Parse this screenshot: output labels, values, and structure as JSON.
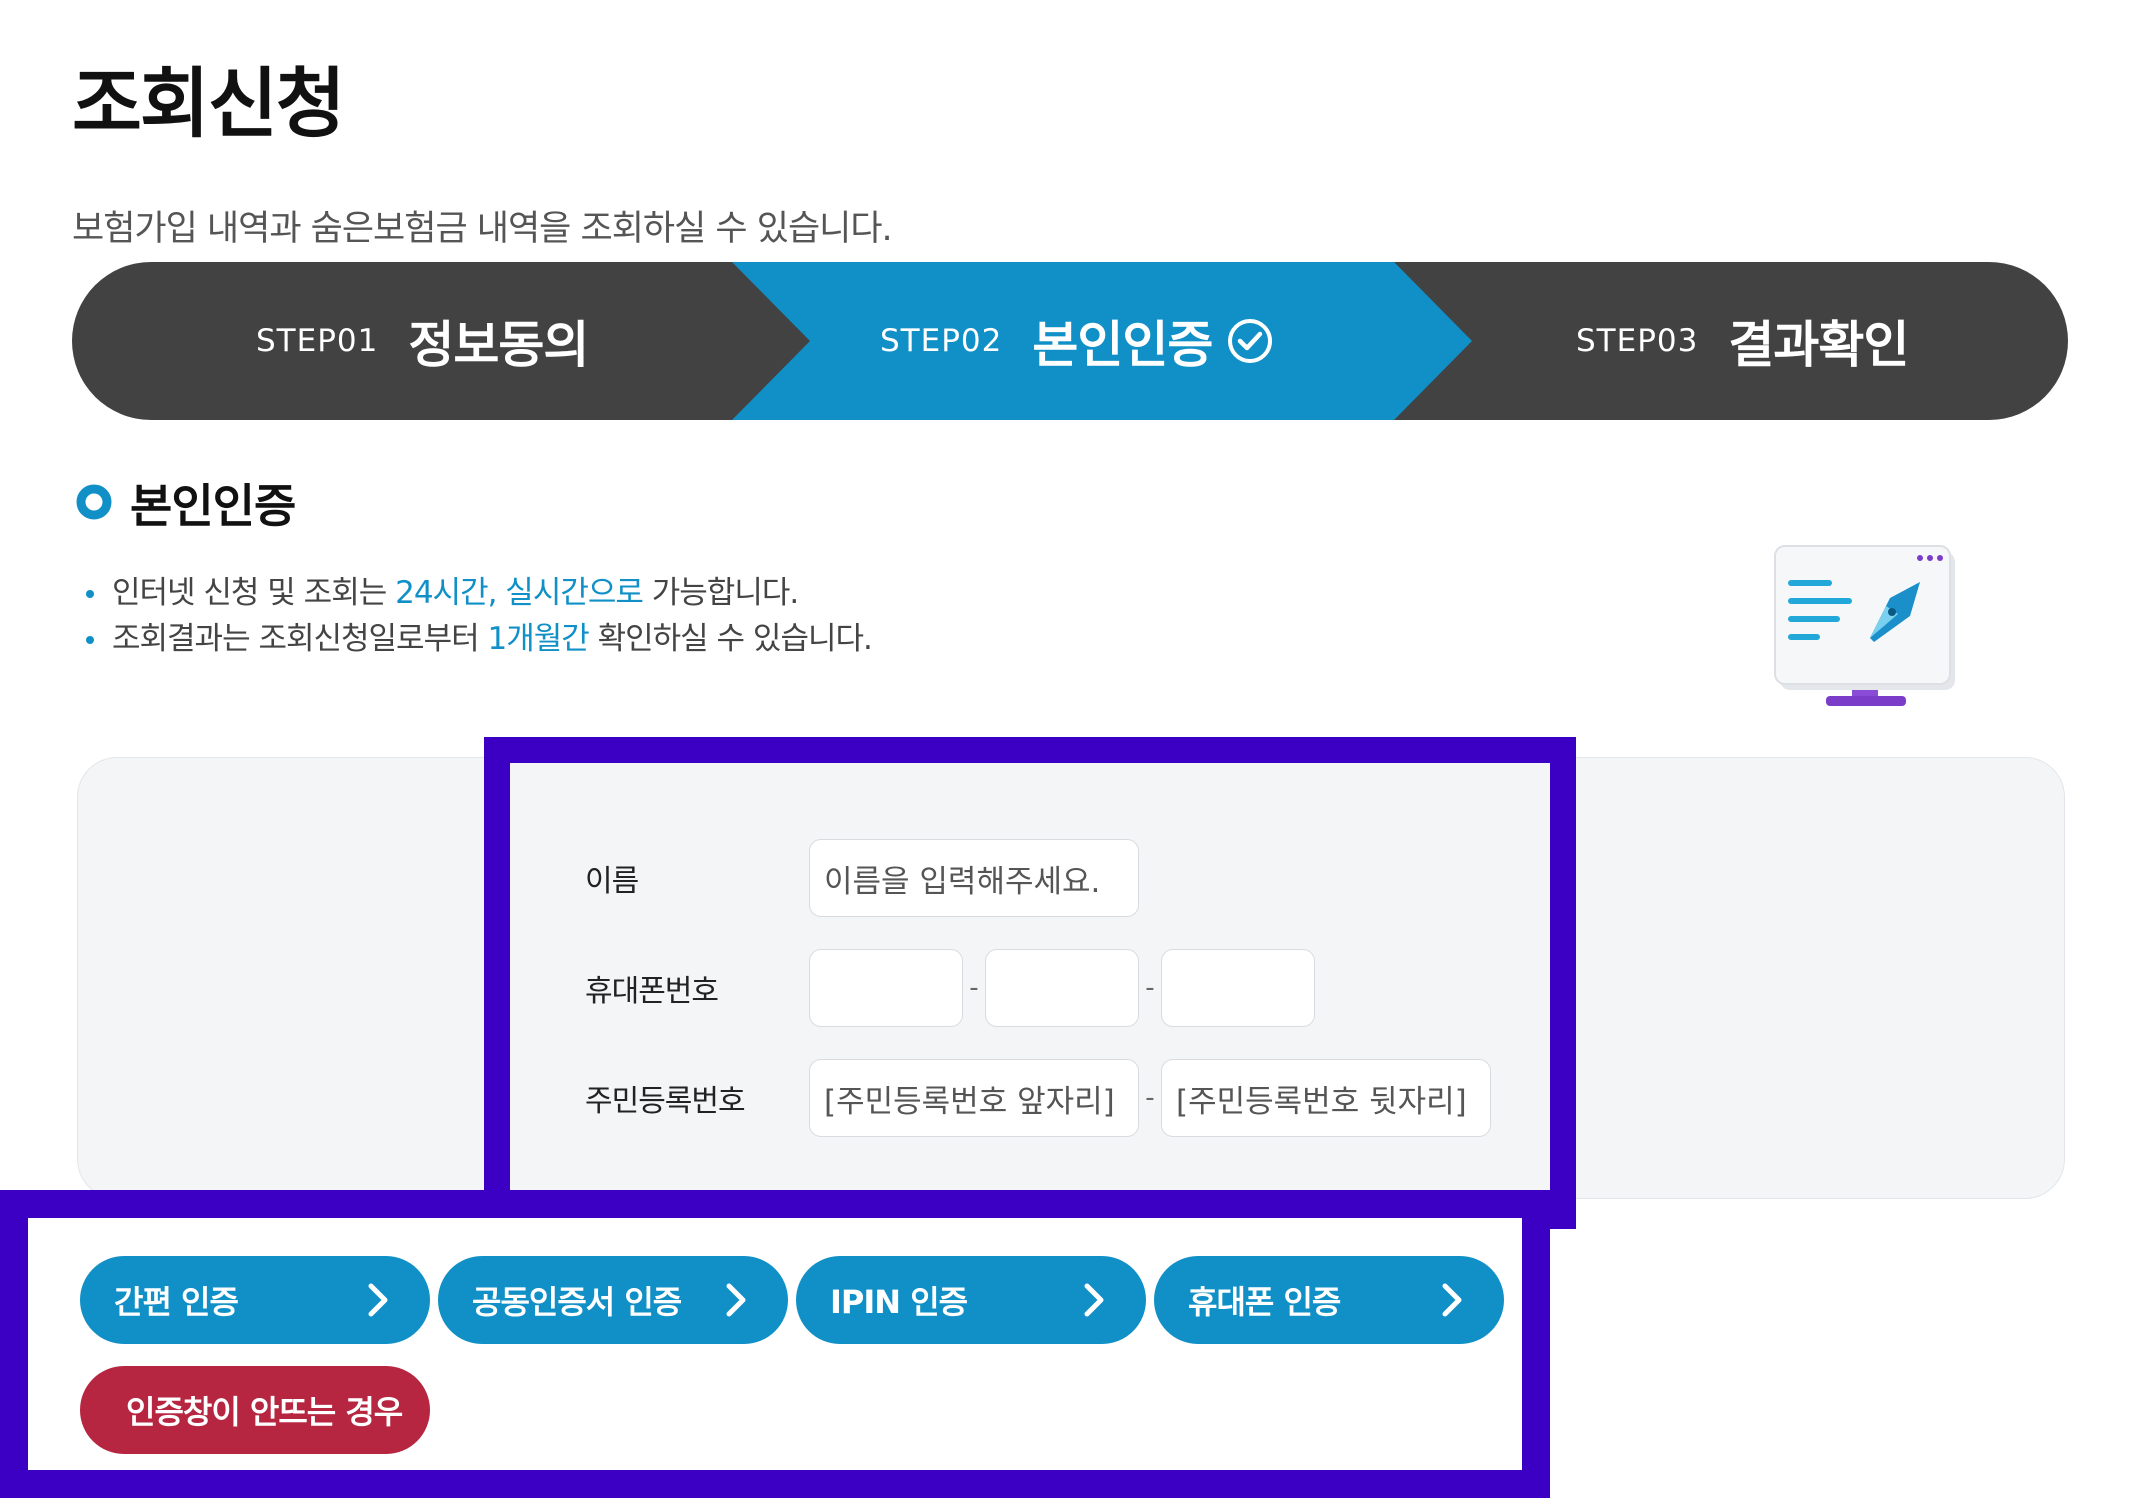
{
  "page": {
    "title": "조회신청",
    "description": "보험가입 내역과 숨은보험금 내역을 조회하실 수 있습니다."
  },
  "steps": [
    {
      "num": "STEP01",
      "name": "정보동의",
      "active": false
    },
    {
      "num": "STEP02",
      "name": "본인인증",
      "active": true
    },
    {
      "num": "STEP03",
      "name": "결과확인",
      "active": false
    }
  ],
  "section": {
    "title": "본인인증",
    "notes": [
      {
        "before": "인터넷 신청 및 조회는 ",
        "highlight": "24시간, 실시간으로",
        "after": " 가능합니다."
      },
      {
        "before": "조회결과는 조회신청일로부터 ",
        "highlight": "1개월간",
        "after": " 확인하실 수 있습니다."
      }
    ]
  },
  "form": {
    "name_label": "이름",
    "name_placeholder": "이름을 입력해주세요.",
    "phone_label": "휴대폰번호",
    "phone_dash": "-",
    "rrn_label": "주민등록번호",
    "rrn_front_placeholder": "[주민등록번호 앞자리]",
    "rrn_back_placeholder": "[주민등록번호 뒷자리]",
    "rrn_dash": "-"
  },
  "buttons": {
    "simple_auth": "간편 인증",
    "joint_cert_auth": "공동인증서 인증",
    "ipin_auth": "IPIN 인증",
    "phone_auth": "휴대폰 인증",
    "popup_help": "인증창이 안뜨는 경우"
  },
  "colors": {
    "accent": "#1090c7",
    "dark": "#424242",
    "danger": "#b72640",
    "highlight_box": "#3c00c4"
  }
}
